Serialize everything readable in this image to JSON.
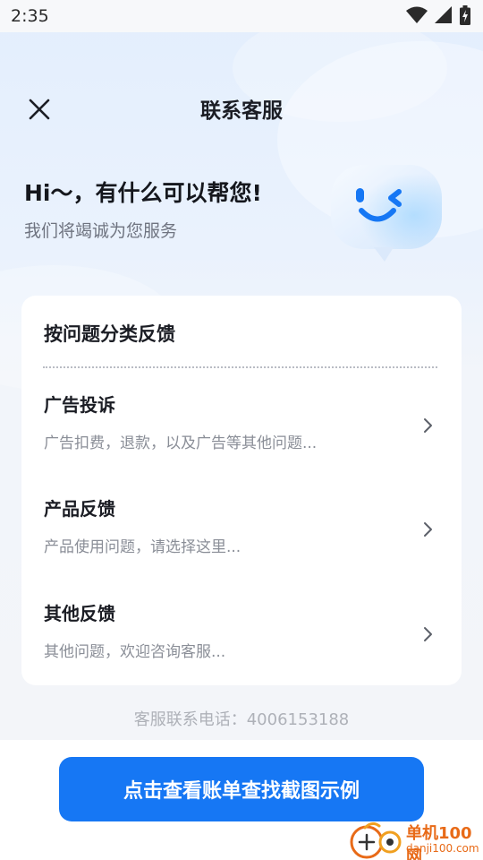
{
  "status_bar": {
    "time": "2:35",
    "icons": [
      "wifi-icon",
      "signal-icon",
      "battery-charging-icon"
    ]
  },
  "header": {
    "title": "联系客服",
    "close_icon": "close-icon"
  },
  "hero": {
    "title": "Hi～，有什么可以帮您!",
    "subtitle": "我们将竭诚为您服务",
    "mascot_icon": "chat-bubble-wink-face-icon"
  },
  "card": {
    "title": "按问题分类反馈",
    "items": [
      {
        "title": "广告投诉",
        "description": "广告扣费，退款，以及广告等其他问题...",
        "icon": "chevron-right-icon"
      },
      {
        "title": "产品反馈",
        "description": "产品使用问题，请选择这里...",
        "icon": "chevron-right-icon"
      },
      {
        "title": "其他反馈",
        "description": "其他问题，欢迎咨询客服...",
        "icon": "chevron-right-icon"
      }
    ]
  },
  "phone_text": "客服联系电话：4006153188",
  "cta_label": "点击查看账单查找截图示例",
  "watermark": {
    "name": "单机100网",
    "url": "danji100.com"
  },
  "colors": {
    "accent": "#1677f4",
    "background": "#eef3fb",
    "card": "#ffffff",
    "watermark": "#e86a17"
  }
}
